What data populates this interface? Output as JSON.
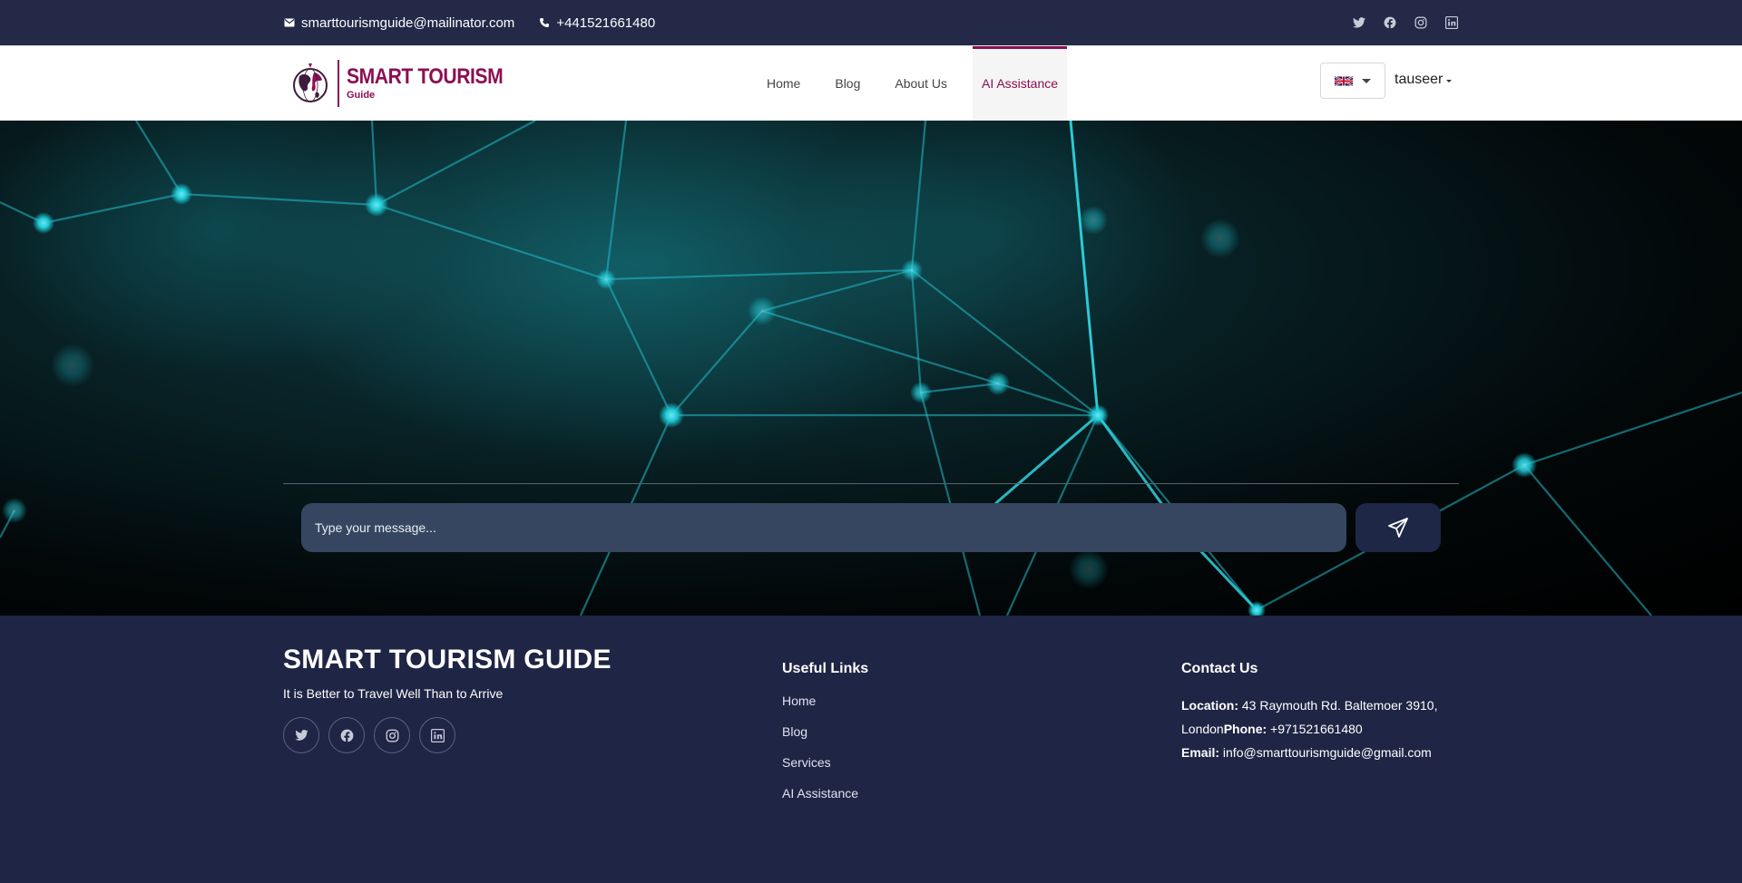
{
  "topbar": {
    "email": "smarttourismguide@mailinator.com",
    "phone": "+441521661480",
    "social_icons": [
      "twitter-icon",
      "facebook-icon",
      "instagram-icon",
      "linkedin-icon"
    ]
  },
  "header": {
    "logo": {
      "line1": "SMART TOURISM",
      "line2": "Guide"
    },
    "nav": [
      {
        "label": "Home",
        "active": false
      },
      {
        "label": "Blog",
        "active": false
      },
      {
        "label": "About Us",
        "active": false
      },
      {
        "label": "AI Assistance",
        "active": true
      }
    ],
    "language_flag": "uk-flag-icon",
    "username": "tauseer"
  },
  "chat": {
    "placeholder": "Type your message...",
    "send_icon": "send-icon"
  },
  "footer": {
    "brand_title": "SMART TOURISM GUIDE",
    "tagline": "It is Better to Travel Well Than to Arrive",
    "social_icons": [
      "twitter-icon",
      "facebook-icon",
      "instagram-icon",
      "linkedin-icon"
    ],
    "links_heading": "Useful Links",
    "links": [
      "Home",
      "Blog",
      "Services",
      "AI Assistance"
    ],
    "contact_heading": "Contact Us",
    "location_label": "Location:",
    "location_value": " 43 Raymouth Rd. Baltemoer 3910, London",
    "phone_label": "Phone:",
    "phone_value": " +971521661480",
    "email_label": "Email:",
    "email_value": " info@smarttourismguide@gmail.com"
  },
  "colors": {
    "brand": "#8c0f52",
    "navy": "#1f2544",
    "input_bg": "#374660",
    "network": "#1fc9d6"
  }
}
